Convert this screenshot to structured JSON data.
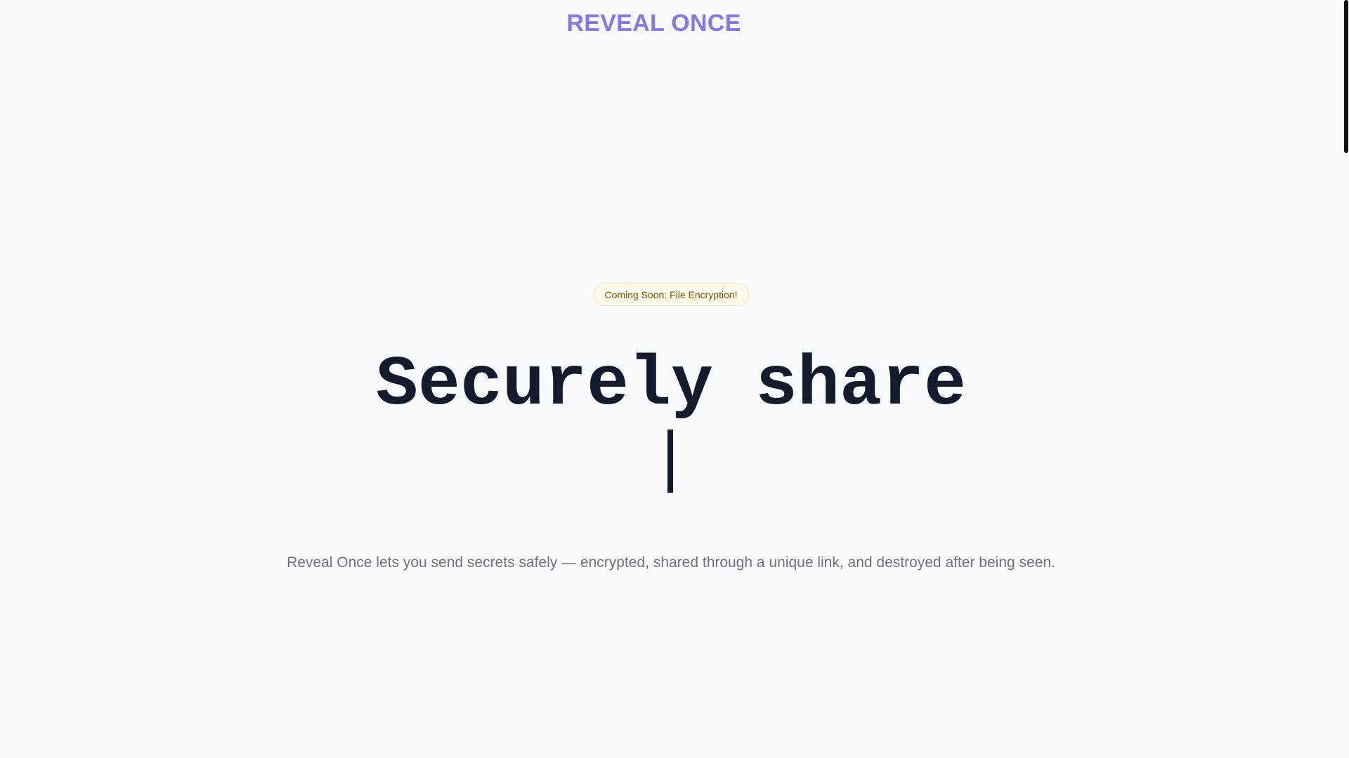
{
  "header": {
    "brand": "REVEAL ONCE"
  },
  "hero": {
    "badge": "Coming Soon: File Encryption!",
    "headline": "Securely share",
    "tagline": "Reveal Once lets you send secrets safely — encrypted, shared through a unique link, and destroyed after being seen."
  },
  "colors": {
    "brand": "#8b74ec",
    "background": "#f8fafc",
    "headline": "#141b2d",
    "tagline": "#6b7280",
    "badge_bg": "#fffbec",
    "badge_border": "#f7e4b8",
    "badge_text": "#7a4f0a"
  }
}
